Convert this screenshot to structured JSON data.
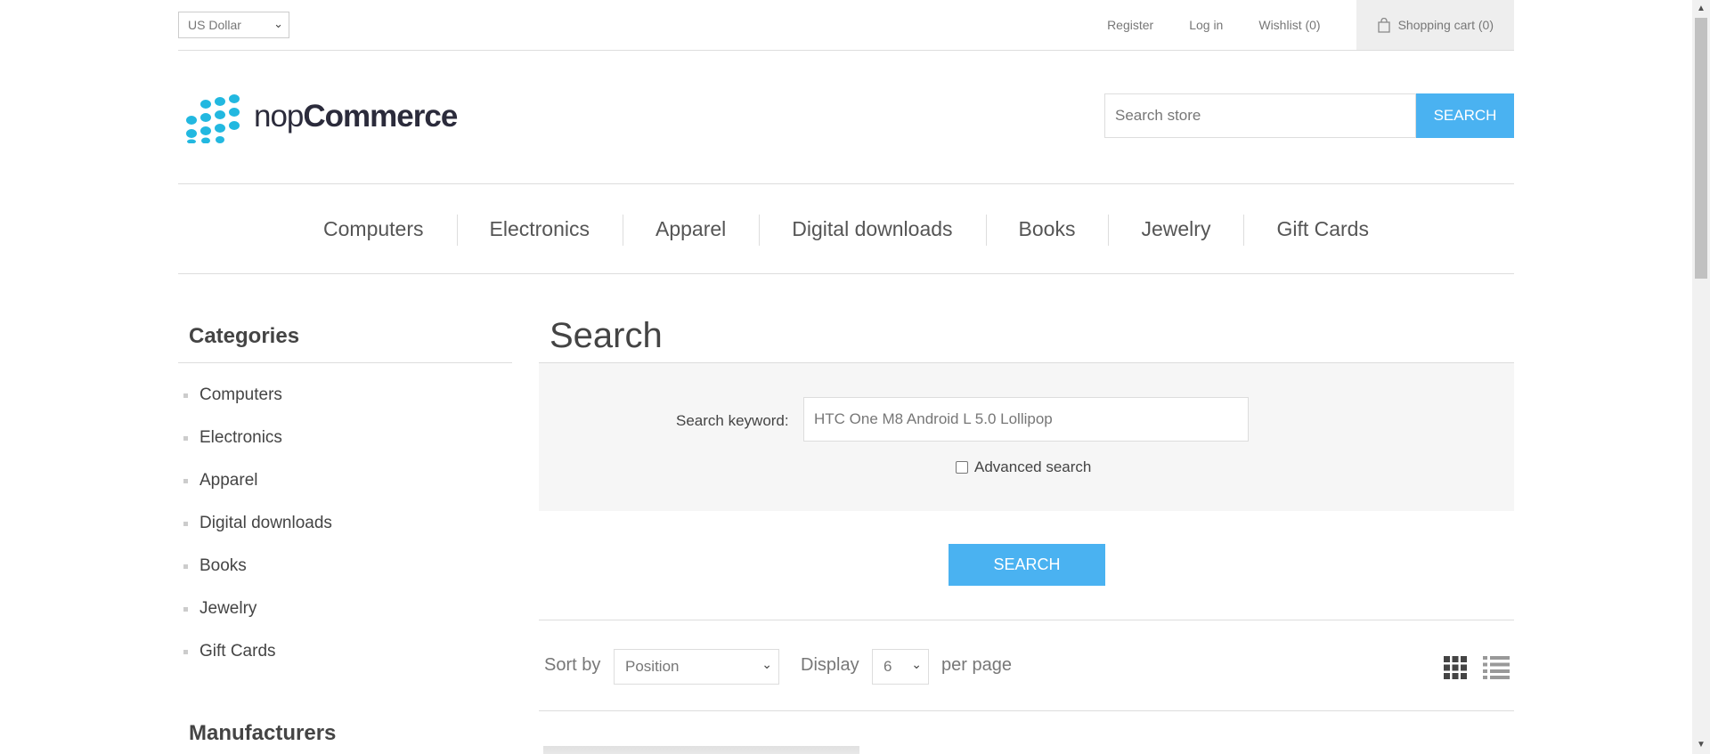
{
  "header": {
    "currency": "US Dollar",
    "links": {
      "register": "Register",
      "login": "Log in",
      "wishlist": "Wishlist (0)",
      "cart": "Shopping cart (0)"
    },
    "logo": {
      "nop": "nop",
      "commerce": "Commerce"
    },
    "search": {
      "placeholder": "Search store",
      "button": "SEARCH"
    }
  },
  "menu": [
    "Computers",
    "Electronics",
    "Apparel",
    "Digital downloads",
    "Books",
    "Jewelry",
    "Gift Cards"
  ],
  "sidebar": {
    "categories_title": "Categories",
    "categories": [
      "Computers",
      "Electronics",
      "Apparel",
      "Digital downloads",
      "Books",
      "Jewelry",
      "Gift Cards"
    ],
    "manufacturers_title": "Manufacturers"
  },
  "main": {
    "title": "Search",
    "keyword_label": "Search keyword:",
    "keyword_value": "HTC One M8 Android L 5.0 Lollipop",
    "advanced_label": "Advanced search",
    "advanced_checked": false,
    "search_button": "SEARCH",
    "sort_label": "Sort by",
    "sort_value": "Position",
    "display_label": "Display",
    "display_value": "6",
    "per_page_label": "per page"
  },
  "colors": {
    "accent": "#4ab2f1",
    "logo_dots": "#22b8e0"
  }
}
